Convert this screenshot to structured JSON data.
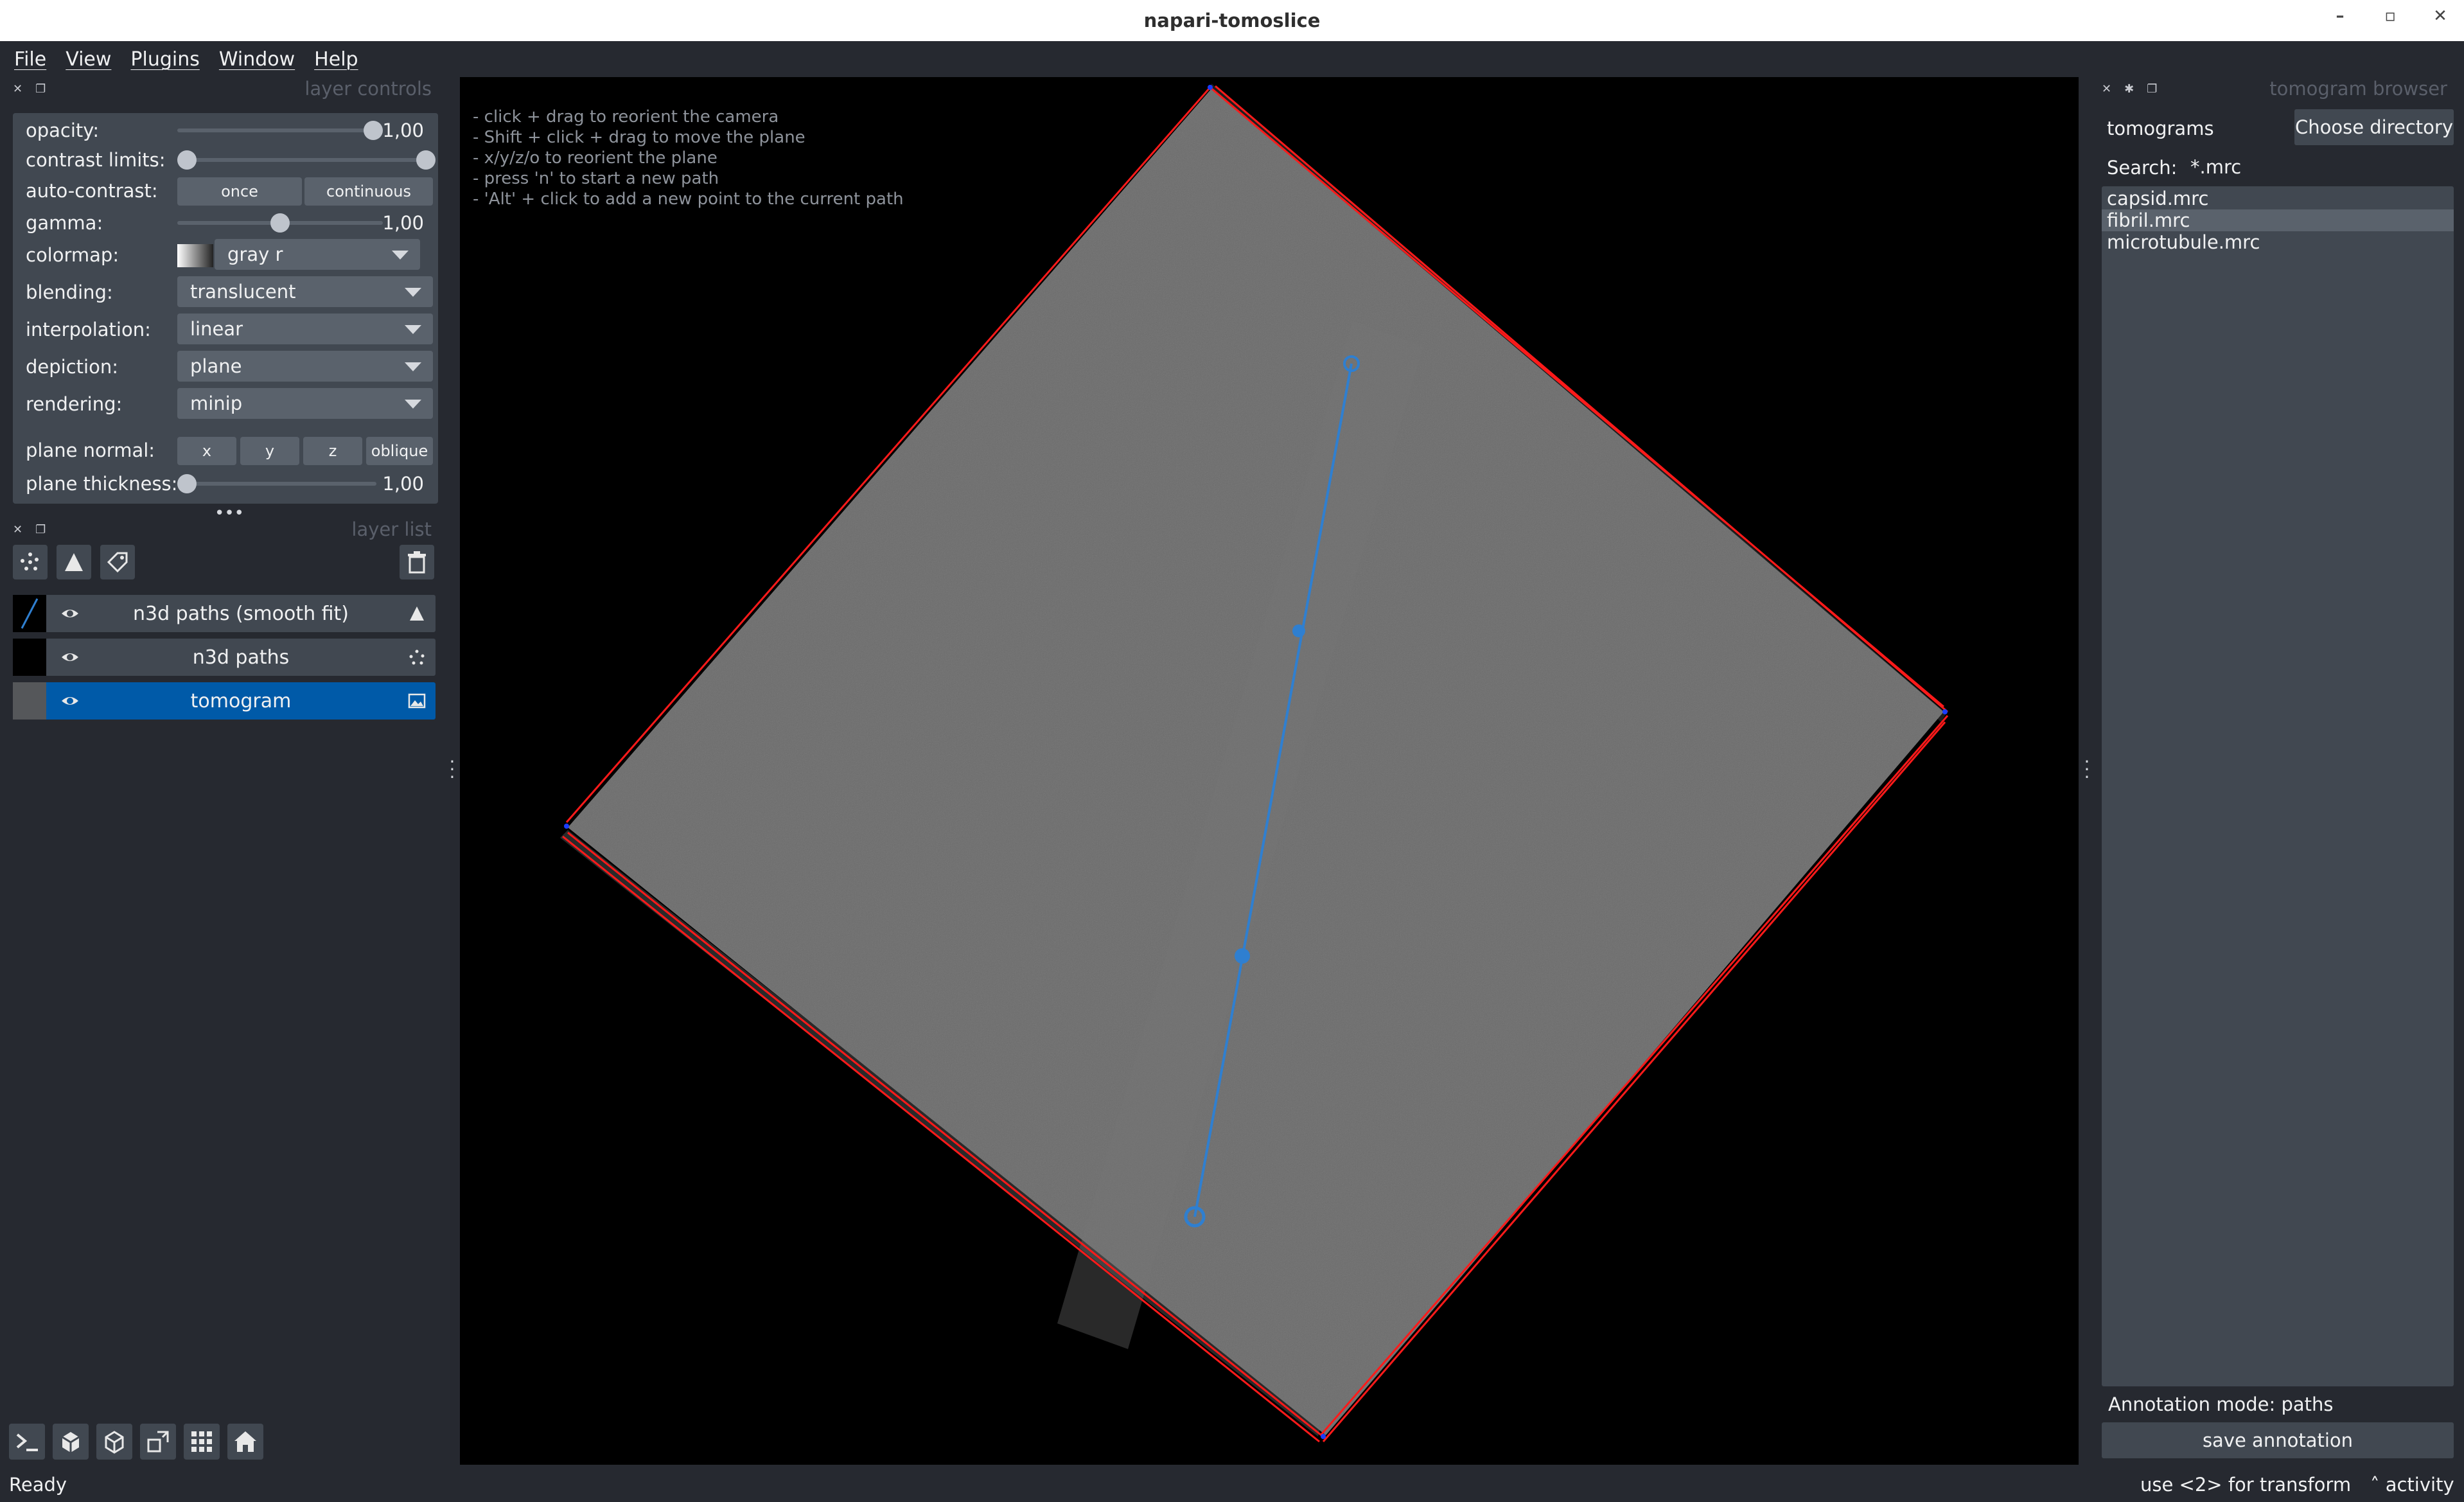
{
  "window": {
    "title": "napari-tomoslice"
  },
  "menu": [
    "File",
    "View",
    "Plugins",
    "Window",
    "Help"
  ],
  "layer_controls": {
    "dock_title": "layer controls",
    "opacity": {
      "label": "opacity:",
      "value": "1,00",
      "fraction": 1.0
    },
    "contrast_limits": {
      "label": "contrast limits:",
      "low_fraction": 0.0,
      "high_fraction": 1.0
    },
    "auto_contrast": {
      "label": "auto-contrast:",
      "buttons": [
        "once",
        "continuous"
      ]
    },
    "gamma": {
      "label": "gamma:",
      "value": "1,00",
      "fraction": 0.5
    },
    "colormap": {
      "label": "colormap:",
      "value": "gray r"
    },
    "blending": {
      "label": "blending:",
      "value": "translucent"
    },
    "interpolation": {
      "label": "interpolation:",
      "value": "linear"
    },
    "depiction": {
      "label": "depiction:",
      "value": "plane"
    },
    "rendering": {
      "label": "rendering:",
      "value": "minip"
    },
    "plane_normal": {
      "label": "plane normal:",
      "buttons": [
        "x",
        "y",
        "z",
        "oblique"
      ]
    },
    "plane_thickness": {
      "label": "plane thickness:",
      "value": "1,00",
      "fraction": 0.0
    }
  },
  "layer_list": {
    "dock_title": "layer list",
    "layers": [
      {
        "name": "n3d paths (smooth fit)",
        "type_icon": "shapes-icon",
        "visible": true,
        "selected": false
      },
      {
        "name": "n3d paths",
        "type_icon": "points-icon",
        "visible": true,
        "selected": false
      },
      {
        "name": "tomogram",
        "type_icon": "image-icon",
        "visible": true,
        "selected": true
      }
    ]
  },
  "canvas": {
    "hints": [
      "- click + drag to reorient the camera",
      "- Shift + click + drag to move the plane",
      "- x/y/z/o to reorient the plane",
      "",
      "- press 'n' to start a new path",
      "- 'Alt' + click to add a new point to the current path"
    ],
    "plane_color": "#6b6b6b",
    "bbox_color": "#ff1a1a",
    "path_color": "#2f7fd0"
  },
  "tomogram_browser": {
    "dock_title": "tomogram browser",
    "directory": "tomograms",
    "choose_directory_label": "Choose directory",
    "search_label": "Search:",
    "search_value": "*.mrc",
    "files": [
      "capsid.mrc",
      "fibril.mrc",
      "microtubule.mrc"
    ],
    "selected_file": "fibril.mrc",
    "annotation_mode": "Annotation mode: paths",
    "save_label": "save annotation"
  },
  "status": {
    "text": "Ready",
    "transform_hint": "use <2> for transform",
    "activity": "activity"
  },
  "colors": {
    "background": "#262930",
    "panel": "#414851",
    "selection": "#005aa8"
  }
}
